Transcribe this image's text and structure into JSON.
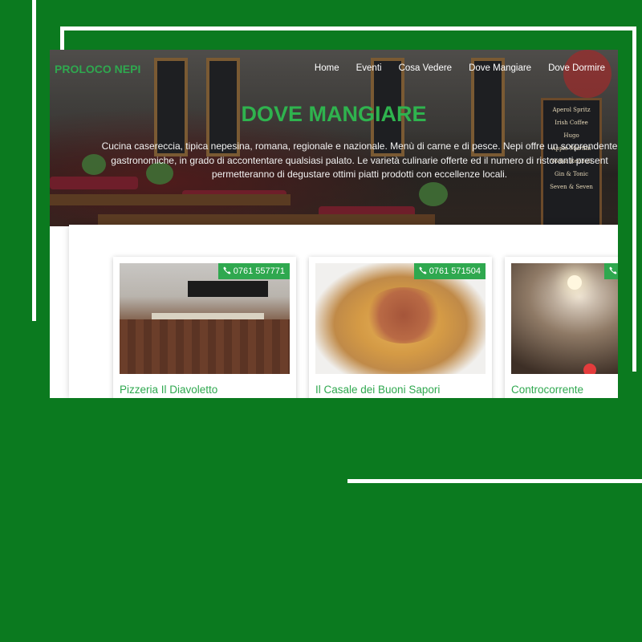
{
  "site": {
    "logo_part1": "PROLOCO",
    "logo_part2": "NEPI"
  },
  "nav": {
    "items": [
      "Home",
      "Eventi",
      "Cosa Vedere",
      "Dove Mangiare",
      "Dove Dormire"
    ]
  },
  "hero": {
    "title": "DOVE MANGIARE",
    "intro_lines": [
      "Cucina casereccia, tipica nepesina, romana, regionale e nazionale. Menù di carne e di pesce. Nepi offre un sorprendente",
      "gastronomiche, in grado di accontentare qualsiasi palato. Le varietà culinarie offerte ed il numero di ristoranti present",
      "permetteranno di degustare ottimi piatti prodotti con eccellenze locali."
    ]
  },
  "cards": [
    {
      "name": "Pizzeria Il Diavoletto",
      "phone": "0761 557771"
    },
    {
      "name": "Il Casale dei Buoni Sapori",
      "phone": "0761 571504"
    },
    {
      "name": "Controcorrente",
      "phone": ""
    }
  ],
  "colors": {
    "background": "#0b7a1f",
    "accent": "#2fa84f",
    "title": "#2fb34e",
    "frame": "#ffffff"
  },
  "icons": {
    "phone": "phone-icon"
  }
}
